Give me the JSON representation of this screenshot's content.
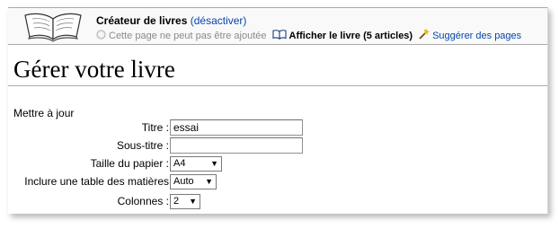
{
  "banner": {
    "title": "Créateur de livres",
    "deactivate": "(désactiver)",
    "page_not_added": "Cette page ne peut pas être ajoutée",
    "show_book": "Afficher le livre (5 articles)",
    "suggest_pages": "Suggérer des pages"
  },
  "page": {
    "heading": "Gérer votre livre",
    "update_link": "Mettre à jour"
  },
  "form": {
    "title_label": "Titre :",
    "title_value": "essai",
    "subtitle_label": "Sous-titre :",
    "subtitle_value": "",
    "paper_size_label": "Taille du papier :",
    "paper_size_value": "A4",
    "toc_label": "Inclure une table des matières",
    "toc_value": "Auto",
    "columns_label": "Colonnes :",
    "columns_value": "2"
  },
  "icons": {
    "book_logo": "open-book-icon",
    "disabled": "disabled-circle-icon",
    "show_book": "book-icon",
    "suggest": "magic-wand-icon"
  },
  "colors": {
    "link": "#0645ad",
    "banner_bg": "#f9f9f9",
    "border": "#aaaaaa",
    "disabled_text": "#8a8a8a"
  }
}
